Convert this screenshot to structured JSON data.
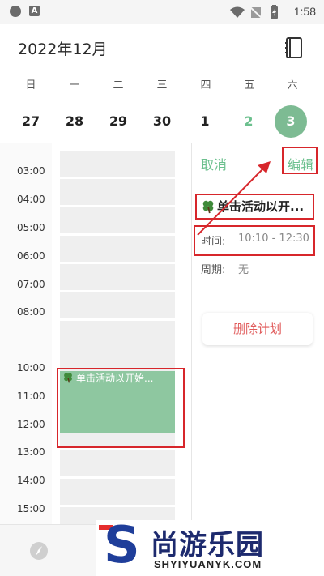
{
  "status_bar": {
    "time": "1:58",
    "notif_letter": "A"
  },
  "header": {
    "month_title": "2022年12月"
  },
  "week": {
    "weekdays": [
      "日",
      "一",
      "二",
      "三",
      "四",
      "五",
      "六"
    ],
    "days": [
      "27",
      "28",
      "29",
      "30",
      "1",
      "2",
      "3"
    ],
    "selected_day": "3"
  },
  "schedule": {
    "hours": [
      "03:00",
      "04:00",
      "05:00",
      "06:00",
      "07:00",
      "08:00",
      "10:00",
      "11:00",
      "12:00",
      "13:00",
      "14:00",
      "15:00"
    ],
    "event_title": "单击活动以开始..."
  },
  "detail": {
    "cancel_label": "取消",
    "edit_label": "编辑",
    "event_name": "单击活动以开...",
    "time_label": "时间:",
    "time_value": "10:10 - 12:30",
    "period_label": "周期:",
    "period_value": "无",
    "delete_label": "删除计划"
  },
  "watermark": {
    "title": "尚游乐园",
    "domain": "SHYIYUANYK.COM",
    "letter": "S"
  },
  "colors": {
    "accent_green": "#6cc08e",
    "event_green": "#8ec7a0",
    "highlight_red": "#d7262b",
    "danger_red": "#e05a5a"
  }
}
